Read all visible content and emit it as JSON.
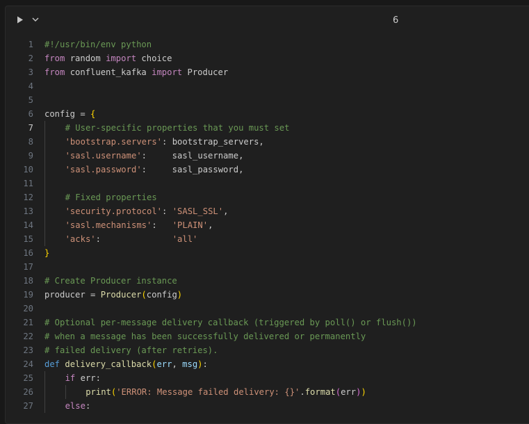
{
  "cell": {
    "execution_count": "6",
    "run_icon": "play-icon",
    "toggle_icon": "chevron-down-icon",
    "active_line": 7
  },
  "lines": [
    {
      "n": "1",
      "indent": 0,
      "tokens": [
        {
          "t": "#!/usr/bin/env python",
          "c": "cm"
        }
      ]
    },
    {
      "n": "2",
      "indent": 0,
      "tokens": [
        {
          "t": "from",
          "c": "kw"
        },
        {
          "t": " random "
        },
        {
          "t": "import",
          "c": "kw"
        },
        {
          "t": " choice"
        }
      ]
    },
    {
      "n": "3",
      "indent": 0,
      "tokens": [
        {
          "t": "from",
          "c": "kw"
        },
        {
          "t": " confluent_kafka "
        },
        {
          "t": "import",
          "c": "kw"
        },
        {
          "t": " Producer"
        }
      ]
    },
    {
      "n": "4",
      "indent": 0,
      "tokens": []
    },
    {
      "n": "5",
      "indent": 0,
      "tokens": []
    },
    {
      "n": "6",
      "indent": 0,
      "tokens": [
        {
          "t": "config"
        },
        {
          "t": " = "
        },
        {
          "t": "{",
          "c": "br"
        }
      ]
    },
    {
      "n": "7",
      "indent": 1,
      "tokens": [
        {
          "t": "# User-specific properties that you must set",
          "c": "cm"
        }
      ]
    },
    {
      "n": "8",
      "indent": 1,
      "tokens": [
        {
          "t": "'bootstrap.servers'",
          "c": "str"
        },
        {
          "t": ": bootstrap_servers,"
        }
      ]
    },
    {
      "n": "9",
      "indent": 1,
      "tokens": [
        {
          "t": "'sasl.username'",
          "c": "str"
        },
        {
          "t": ":     sasl_username,"
        }
      ]
    },
    {
      "n": "10",
      "indent": 1,
      "tokens": [
        {
          "t": "'sasl.password'",
          "c": "str"
        },
        {
          "t": ":     sasl_password,"
        }
      ]
    },
    {
      "n": "11",
      "indent": 1,
      "tokens": []
    },
    {
      "n": "12",
      "indent": 1,
      "tokens": [
        {
          "t": "# Fixed properties",
          "c": "cm"
        }
      ]
    },
    {
      "n": "13",
      "indent": 1,
      "tokens": [
        {
          "t": "'security.protocol'",
          "c": "str"
        },
        {
          "t": ": "
        },
        {
          "t": "'SASL_SSL'",
          "c": "str"
        },
        {
          "t": ","
        }
      ]
    },
    {
      "n": "14",
      "indent": 1,
      "tokens": [
        {
          "t": "'sasl.mechanisms'",
          "c": "str"
        },
        {
          "t": ":   "
        },
        {
          "t": "'PLAIN'",
          "c": "str"
        },
        {
          "t": ","
        }
      ]
    },
    {
      "n": "15",
      "indent": 1,
      "tokens": [
        {
          "t": "'acks'",
          "c": "str"
        },
        {
          "t": ":              "
        },
        {
          "t": "'all'",
          "c": "str"
        }
      ]
    },
    {
      "n": "16",
      "indent": 0,
      "tokens": [
        {
          "t": "}",
          "c": "br"
        }
      ]
    },
    {
      "n": "17",
      "indent": 0,
      "tokens": []
    },
    {
      "n": "18",
      "indent": 0,
      "tokens": [
        {
          "t": "# Create Producer instance",
          "c": "cm"
        }
      ]
    },
    {
      "n": "19",
      "indent": 0,
      "tokens": [
        {
          "t": "producer"
        },
        {
          "t": " = "
        },
        {
          "t": "Producer",
          "c": "fn"
        },
        {
          "t": "(",
          "c": "br"
        },
        {
          "t": "config"
        },
        {
          "t": ")",
          "c": "br"
        }
      ]
    },
    {
      "n": "20",
      "indent": 0,
      "tokens": []
    },
    {
      "n": "21",
      "indent": 0,
      "tokens": [
        {
          "t": "# Optional per-message delivery callback (triggered by poll() or flush())",
          "c": "cm"
        }
      ]
    },
    {
      "n": "22",
      "indent": 0,
      "tokens": [
        {
          "t": "# when a message has been successfully delivered or permanently",
          "c": "cm"
        }
      ]
    },
    {
      "n": "23",
      "indent": 0,
      "tokens": [
        {
          "t": "# failed delivery (after retries).",
          "c": "cm"
        }
      ]
    },
    {
      "n": "24",
      "indent": 0,
      "tokens": [
        {
          "t": "def",
          "c": "def"
        },
        {
          "t": " "
        },
        {
          "t": "delivery_callback",
          "c": "fn"
        },
        {
          "t": "(",
          "c": "br"
        },
        {
          "t": "err",
          "c": "var"
        },
        {
          "t": ", "
        },
        {
          "t": "msg",
          "c": "var"
        },
        {
          "t": ")",
          "c": "br"
        },
        {
          "t": ":"
        }
      ]
    },
    {
      "n": "25",
      "indent": 1,
      "tokens": [
        {
          "t": "if",
          "c": "kw"
        },
        {
          "t": " err:"
        }
      ]
    },
    {
      "n": "26",
      "indent": 2,
      "tokens": [
        {
          "t": "print",
          "c": "fn"
        },
        {
          "t": "(",
          "c": "br"
        },
        {
          "t": "'ERROR: Message failed delivery: {}'",
          "c": "str"
        },
        {
          "t": "."
        },
        {
          "t": "format",
          "c": "fn"
        },
        {
          "t": "(",
          "c": "br2"
        },
        {
          "t": "err"
        },
        {
          "t": ")",
          "c": "br2"
        },
        {
          "t": ")",
          "c": "br"
        }
      ]
    },
    {
      "n": "27",
      "indent": 1,
      "tokens": [
        {
          "t": "else",
          "c": "kw"
        },
        {
          "t": ":"
        }
      ]
    }
  ]
}
